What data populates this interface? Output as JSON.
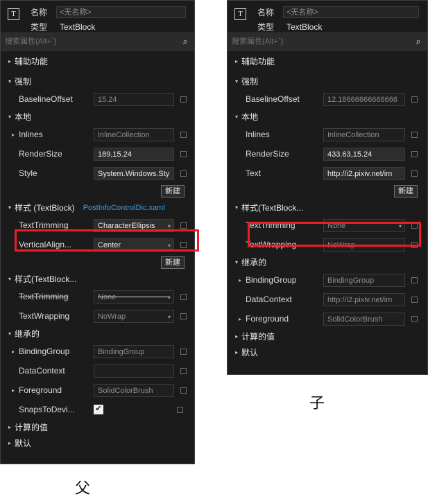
{
  "captions": {
    "parent": "父",
    "child": "子"
  },
  "icons": {
    "type_glyph": "T",
    "search_icon": "⌕",
    "checked": "✔"
  },
  "parent_panel": {
    "header": {
      "name_label": "名称",
      "name_value": "<无名称>",
      "type_label": "类型",
      "type_value": "TextBlock"
    },
    "search": {
      "placeholder": "搜索属性(Alt+`)",
      "value": ""
    },
    "groups": [
      {
        "label": "辅助功能",
        "state": "collapsed"
      },
      {
        "label": "强制",
        "state": "expanded"
      },
      {
        "label": "本地",
        "state": "expanded"
      },
      {
        "label": "样式 (TextBlock)",
        "state": "expanded",
        "link": "PostInfoControlDic.xaml"
      },
      {
        "label": "样式(TextBlock...",
        "state": "expanded"
      },
      {
        "label": "继承的",
        "state": "expanded"
      },
      {
        "label": "计算的值",
        "state": "collapsed"
      },
      {
        "label": "默认",
        "state": "collapsed"
      }
    ],
    "rows": {
      "baseline_offset": {
        "name": "BaselineOffset",
        "value": "15.24"
      },
      "inlines": {
        "name": "Inlines",
        "value": "InlineCollection"
      },
      "render_size": {
        "name": "RenderSize",
        "value": "189,15.24"
      },
      "style": {
        "name": "Style",
        "value": "System.Windows.Sty"
      },
      "text_trimming_style": {
        "name": "TextTrimming",
        "value": "CharacterEllipsis"
      },
      "vertical_align": {
        "name": "VerticalAlign...",
        "value": "Center"
      },
      "text_trimming_style2": {
        "name": "TextTrimming",
        "value": "None"
      },
      "text_wrapping": {
        "name": "TextWrapping",
        "value": "NoWrap"
      },
      "binding_group": {
        "name": "BindingGroup",
        "value": "BindingGroup"
      },
      "data_context": {
        "name": "DataContext",
        "value": ""
      },
      "foreground": {
        "name": "Foreground",
        "value": "SolidColorBrush"
      },
      "snaps_to_device": {
        "name": "SnapsToDevi...",
        "value": ""
      }
    },
    "new_button_label": "新建"
  },
  "child_panel": {
    "header": {
      "name_label": "名称",
      "name_value": "<无名称>",
      "type_label": "类型",
      "type_value": "TextBlock"
    },
    "search": {
      "placeholder": "搜索属性(Alt+`)",
      "value": ""
    },
    "groups": [
      {
        "label": "辅助功能",
        "state": "collapsed"
      },
      {
        "label": "强制",
        "state": "expanded"
      },
      {
        "label": "本地",
        "state": "expanded"
      },
      {
        "label": "样式(TextBlock...",
        "state": "expanded"
      },
      {
        "label": "继承的",
        "state": "expanded"
      },
      {
        "label": "计算的值",
        "state": "collapsed"
      },
      {
        "label": "默认",
        "state": "collapsed"
      }
    ],
    "rows": {
      "baseline_offset": {
        "name": "BaselineOffset",
        "value": "12.18666666666666"
      },
      "inlines": {
        "name": "Inlines",
        "value": "InlineCollection"
      },
      "render_size": {
        "name": "RenderSize",
        "value": "433.63,15.24"
      },
      "text": {
        "name": "Text",
        "value": "http://i2.pixiv.net/im"
      },
      "text_trimming": {
        "name": "TextTrimming",
        "value": "None"
      },
      "text_wrapping": {
        "name": "TextWrapping",
        "value": "NoWrap"
      },
      "binding_group": {
        "name": "BindingGroup",
        "value": "BindingGroup"
      },
      "data_context": {
        "name": "DataContext",
        "value": "http://i2.pixiv.net/im"
      },
      "foreground": {
        "name": "Foreground",
        "value": "SolidColorBrush"
      }
    },
    "new_button_label": "新建"
  },
  "colors": {
    "highlight": "#ee1c26",
    "panel_bg": "#1b1b1c",
    "link": "#3d9fe0"
  }
}
